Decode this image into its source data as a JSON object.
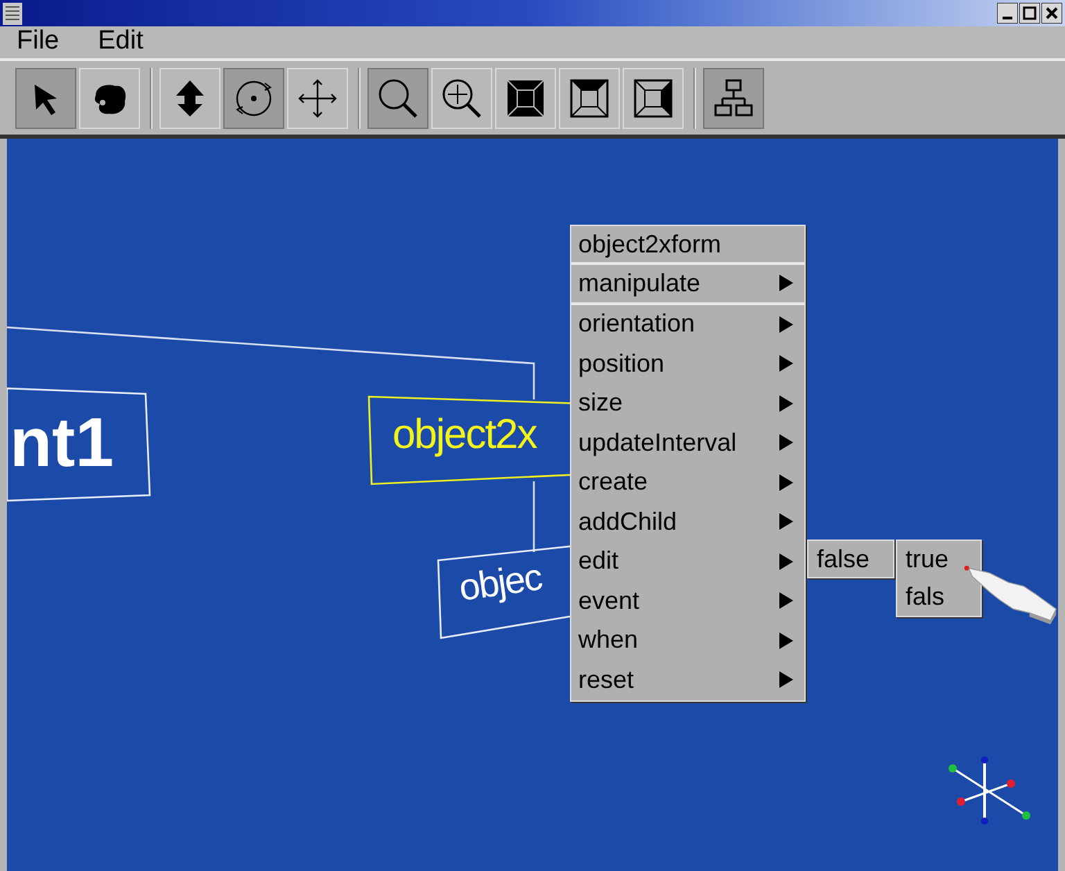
{
  "menubar": [
    "File",
    "Edit"
  ],
  "toolbar": [
    {
      "kind": "select",
      "selected": true
    },
    {
      "kind": "grab",
      "selected": false
    },
    {
      "kind": "lift",
      "selected": false
    },
    {
      "kind": "rotate",
      "selected": true
    },
    {
      "kind": "move",
      "selected": false
    },
    {
      "kind": "zoom",
      "selected": true
    },
    {
      "kind": "zoom-move",
      "selected": false
    },
    {
      "kind": "view-front",
      "selected": false
    },
    {
      "kind": "view-top",
      "selected": false
    },
    {
      "kind": "view-side",
      "selected": false
    },
    {
      "kind": "tree",
      "selected": true
    }
  ],
  "scene": {
    "nodes": [
      {
        "label": "nt1",
        "highlighted": false
      },
      {
        "label": "object2x",
        "highlighted": true
      },
      {
        "label": "objec",
        "highlighted": false
      }
    ]
  },
  "context_menu": {
    "title": "object2xform",
    "items": [
      {
        "label": "manipulate",
        "submenu": true
      },
      {
        "label": "orientation",
        "submenu": true
      },
      {
        "label": "position",
        "submenu": true
      },
      {
        "label": "size",
        "submenu": true
      },
      {
        "label": "updateInterval",
        "submenu": true
      },
      {
        "label": "create",
        "submenu": true
      },
      {
        "label": "addChild",
        "submenu": true
      },
      {
        "label": "edit",
        "submenu": true
      },
      {
        "label": "event",
        "submenu": true
      },
      {
        "label": "when",
        "submenu": true
      },
      {
        "label": "reset",
        "submenu": true
      }
    ],
    "submenu": [
      "false"
    ],
    "value_menu": [
      "true",
      "fals"
    ]
  }
}
